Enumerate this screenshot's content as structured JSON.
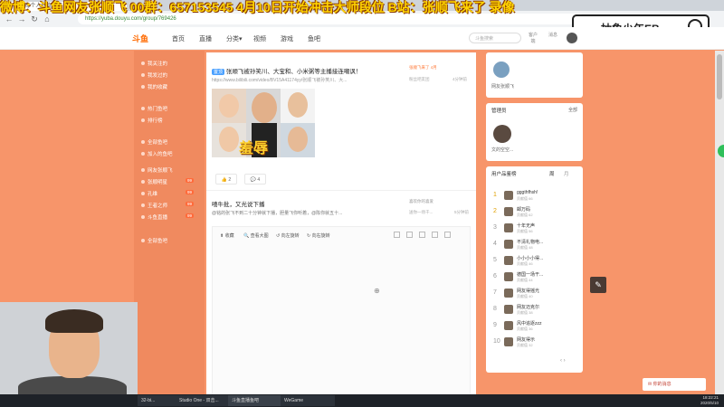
{
  "overlay_banner": "微博：斗鱼网友张顺飞  00群：657153545  4月10日开始冲击大师段位  B站：张顺飞来了  录像",
  "browser": {
    "tab_title": "斗鱼 - 每个人的直播平台",
    "url": "https://yuba.douyu.com/group/769426",
    "nav_back": "←",
    "nav_forward": "→",
    "nav_reload": "↻",
    "nav_home": "⌂"
  },
  "stream_search": {
    "text": "抽象少年EB"
  },
  "site_header": {
    "logo": "斗鱼",
    "nav": [
      "首页",
      "直播",
      "分类▾",
      "视频",
      "游戏",
      "鱼吧"
    ],
    "search_placeholder": "斗鱼搜索",
    "icons": [
      "客户端",
      "消息"
    ]
  },
  "sidebar": {
    "items": [
      {
        "label": "我关注的",
        "count": ""
      },
      {
        "label": "我发过的",
        "count": ""
      },
      {
        "label": "我的收藏",
        "count": ""
      },
      {
        "label": "热门鱼吧",
        "count": ""
      },
      {
        "label": "排行榜",
        "count": ""
      },
      {
        "label": "全部鱼吧",
        "count": ""
      },
      {
        "label": "加入的鱼吧",
        "count": ""
      },
      {
        "label": "网友张顺飞",
        "count": ""
      },
      {
        "label": "张顺明星",
        "count": "99"
      },
      {
        "label": "孔维",
        "count": "99"
      },
      {
        "label": "王者之师",
        "count": "99"
      },
      {
        "label": "斗鱼直播",
        "count": "99"
      },
      {
        "label": "全部鱼吧",
        "count": ""
      }
    ]
  },
  "post1": {
    "tag": "置顶",
    "title": "张顺飞被孙笑川、大宝和、小米粥等主播接连嘲讽！",
    "link": "https://www.bilibili.com/video/BV15A41174yy/张顺飞被孙笑川、大...",
    "meta_top": "张顺飞来了 4月",
    "meta_mid": "粉丝吧友团",
    "meta_right": "4分钟前",
    "sticker": "羞辱",
    "likes": "2",
    "comments": "4"
  },
  "post2": {
    "title": "嘻牛批，又光说下播",
    "sub": "@铭的张飞不到二十分钟就下播，胆量飞你听着，@陈你就五十...",
    "meta_top": "喜欢你的喜爱",
    "meta_mid": "送你一场干...",
    "meta_right": "5分钟前"
  },
  "editor_toolbar": {
    "items": [
      "收藏",
      "查看大图",
      "向左旋转",
      "向右旋转"
    ]
  },
  "right_panel": {
    "profile_name": "网友张顺飞",
    "admins_title": "管理员",
    "admins_more": "全部",
    "admin_name": "文的空空...",
    "rank_title": "用户品鉴榜",
    "rank_tabs": [
      "周",
      "月"
    ],
    "rank": [
      {
        "num": "1",
        "name": "gggthfhsh!",
        "sub": "贡献值 66"
      },
      {
        "num": "2",
        "name": "邮万码",
        "sub": "贡献值 62"
      },
      {
        "num": "3",
        "name": "十年无声",
        "sub": "贡献值 56"
      },
      {
        "num": "4",
        "name": "不清礼物电...",
        "sub": "贡献值 48"
      },
      {
        "num": "5",
        "name": "小小小小得...",
        "sub": "贡献值 46"
      },
      {
        "num": "6",
        "name": "德国一场干...",
        "sub": "贡献值 44"
      },
      {
        "num": "7",
        "name": "网友得摇光",
        "sub": "贡献值 40"
      },
      {
        "num": "8",
        "name": "网友迈克尔",
        "sub": "贡献值 38"
      },
      {
        "num": "9",
        "name": "风中追逐zzz",
        "sub": "贡献值 36"
      },
      {
        "num": "10",
        "name": "网友得示",
        "sub": "贡献值 32"
      }
    ],
    "pager": "‹ ›"
  },
  "toast": "你的消息",
  "taskbar": {
    "items": [
      "32-bi...",
      "Studio One - 双击...",
      "斗鱼直播鱼吧",
      "WeGame"
    ],
    "time": "18:22:21",
    "date": "2020/5/10"
  }
}
